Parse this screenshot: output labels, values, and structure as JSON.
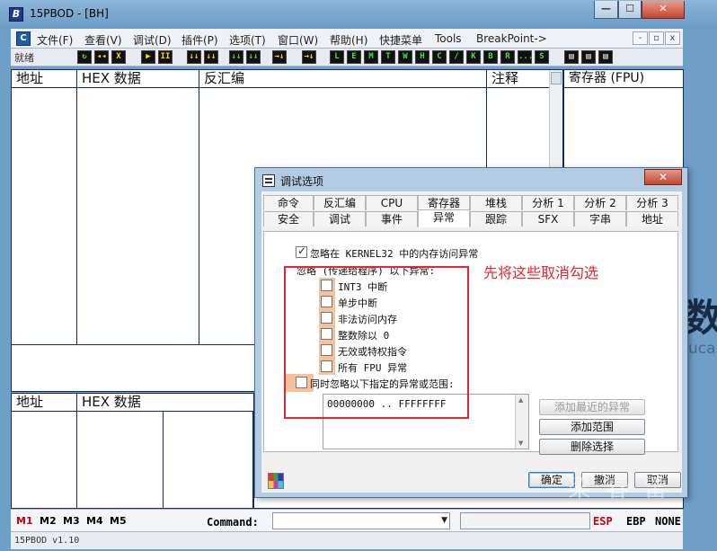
{
  "window": {
    "title": "15PBOD - [BH]",
    "app_logo_glyph": "B",
    "min_glyph": "—",
    "max_glyph": "☐",
    "close_glyph": "✕"
  },
  "menubar": {
    "logo_glyph": "C",
    "items": [
      "文件(F)",
      "查看(V)",
      "调试(D)",
      "插件(P)",
      "选项(T)",
      "窗口(W)",
      "帮助(H)",
      "快捷菜单",
      "Tools",
      "BreakPoint->"
    ],
    "mdi_min": "-",
    "mdi_restore": "▫",
    "mdi_close": "x"
  },
  "toolbar": {
    "status": "就绪",
    "buttons": [
      "↻",
      "◂◂",
      "X",
      "▶",
      "II",
      "↓↓",
      "↓↓",
      "↓↓",
      "↓↓",
      "→↓",
      "L",
      "E",
      "M",
      "T",
      "W",
      "H",
      "C",
      "/",
      "K",
      "B",
      "R",
      "...",
      "S",
      "▤",
      "▤",
      "▤"
    ]
  },
  "cpu_pane": {
    "headers": [
      "地址",
      "HEX 数据",
      "反汇编",
      "注释"
    ]
  },
  "reg_pane": {
    "header": "寄存器 (FPU)"
  },
  "dump_pane": {
    "headers": [
      "地址",
      "HEX 数据"
    ]
  },
  "statusline": {
    "mem_tabs": [
      "M1",
      "M2",
      "M3",
      "M4",
      "M5"
    ],
    "command_label": "Command:",
    "command_value": "",
    "cmd_arrow": "▼",
    "reg_indicators": [
      "ESP",
      "EBP",
      "NONE"
    ]
  },
  "footer": {
    "version": "15PBOD  v1.10"
  },
  "background": {
    "big_char": "数",
    "small_text": "uca"
  },
  "dialog": {
    "title": "调试选项",
    "close_glyph": "✕",
    "tabs_row1": [
      "命令",
      "反汇编",
      "CPU",
      "寄存器",
      "堆栈",
      "分析 1",
      "分析 2",
      "分析 3"
    ],
    "tabs_row2": [
      "安全",
      "调试",
      "事件",
      "异常",
      "跟踪",
      "SFX",
      "字串",
      "地址"
    ],
    "active_tab": "异常",
    "ignore_kernel32": {
      "label": "忽略在 KERNEL32 中的内存访问异常",
      "checked": true
    },
    "group_label": "忽略 (传递给程序) 以下异常:",
    "exceptions": [
      {
        "label": "INT3 中断",
        "checked": false
      },
      {
        "label": "单步中断",
        "checked": false
      },
      {
        "label": "非法访问内存",
        "checked": false
      },
      {
        "label": "整数除以 0",
        "checked": false
      },
      {
        "label": "无效或特权指令",
        "checked": false
      },
      {
        "label": "所有 FPU 异常",
        "checked": false
      }
    ],
    "ignore_range": {
      "label": "同时忽略以下指定的异常或范围:",
      "checked": false
    },
    "range_list": [
      "00000000 .. FFFFFFFF"
    ],
    "buttons": {
      "add_last": "添加最近的异常",
      "add_range": "添加范围",
      "delete_sel": "删除选择",
      "ok": "确定",
      "cancel": "撤消",
      "cancel2": "取消"
    },
    "annotation": "先将这些取消勾选",
    "scroll_up": "▲",
    "scroll_down": "▼"
  },
  "watermark": "梁 春 雷"
}
